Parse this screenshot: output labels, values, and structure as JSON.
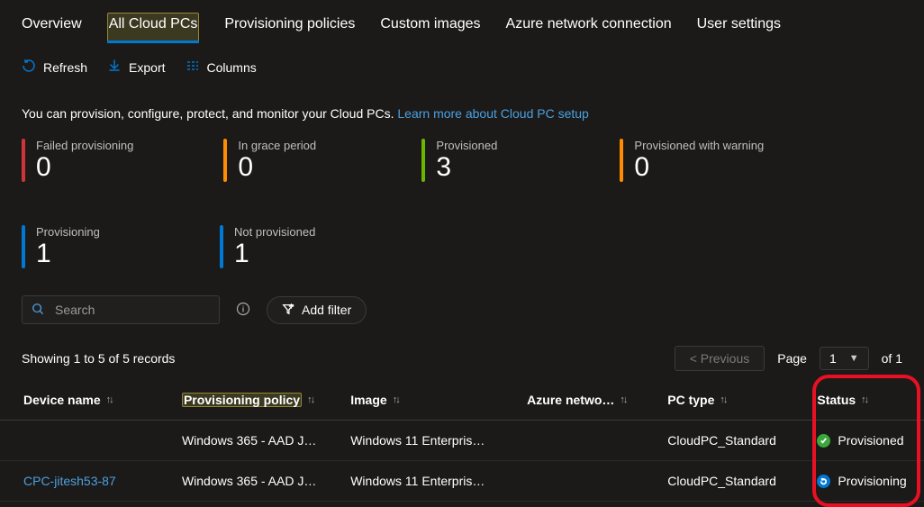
{
  "tabs": [
    {
      "label": "Overview",
      "active": false
    },
    {
      "label": "All Cloud PCs",
      "active": true,
      "highlight": true
    },
    {
      "label": "Provisioning policies",
      "active": false
    },
    {
      "label": "Custom images",
      "active": false
    },
    {
      "label": "Azure network connection",
      "active": false
    },
    {
      "label": "User settings",
      "active": false
    }
  ],
  "toolbar": {
    "refresh": "Refresh",
    "export": "Export",
    "columns": "Columns"
  },
  "intro": {
    "text": "You can provision, configure, protect, and monitor your Cloud PCs. ",
    "link_text": "Learn more about Cloud PC setup"
  },
  "kpis": [
    {
      "label": "Failed provisioning",
      "value": "0",
      "color": "#d13438"
    },
    {
      "label": "In grace period",
      "value": "0",
      "color": "#ff8c00"
    },
    {
      "label": "Provisioned",
      "value": "3",
      "color": "#6bb700"
    },
    {
      "label": "Provisioned with warning",
      "value": "0",
      "color": "#ff8c00"
    },
    {
      "label": "Provisioning",
      "value": "1",
      "color": "#0078d4"
    },
    {
      "label": "Not provisioned",
      "value": "1",
      "color": "#0078d4"
    }
  ],
  "controls": {
    "search_placeholder": "Search",
    "add_filter": "Add filter"
  },
  "meta": {
    "showing": "Showing 1 to 5 of 5 records",
    "previous": "< Previous",
    "page_label": "Page",
    "page_value": "1",
    "of_label": "of 1"
  },
  "columns": {
    "device": "Device name",
    "policy": "Provisioning policy",
    "image": "Image",
    "net": "Azure netwo…",
    "type": "PC type",
    "status": "Status"
  },
  "rows": [
    {
      "device": "",
      "policy": "Windows 365 - AAD J…",
      "image": "Windows 11 Enterpris…",
      "net": "",
      "type": "CloudPC_Standard",
      "status": "Provisioned",
      "status_kind": "green"
    },
    {
      "device": "CPC-jitesh53-87",
      "policy": "Windows 365 - AAD J…",
      "image": "Windows 11 Enterpris…",
      "net": "",
      "type": "CloudPC_Standard",
      "status": "Provisioning",
      "status_kind": "blue"
    }
  ]
}
